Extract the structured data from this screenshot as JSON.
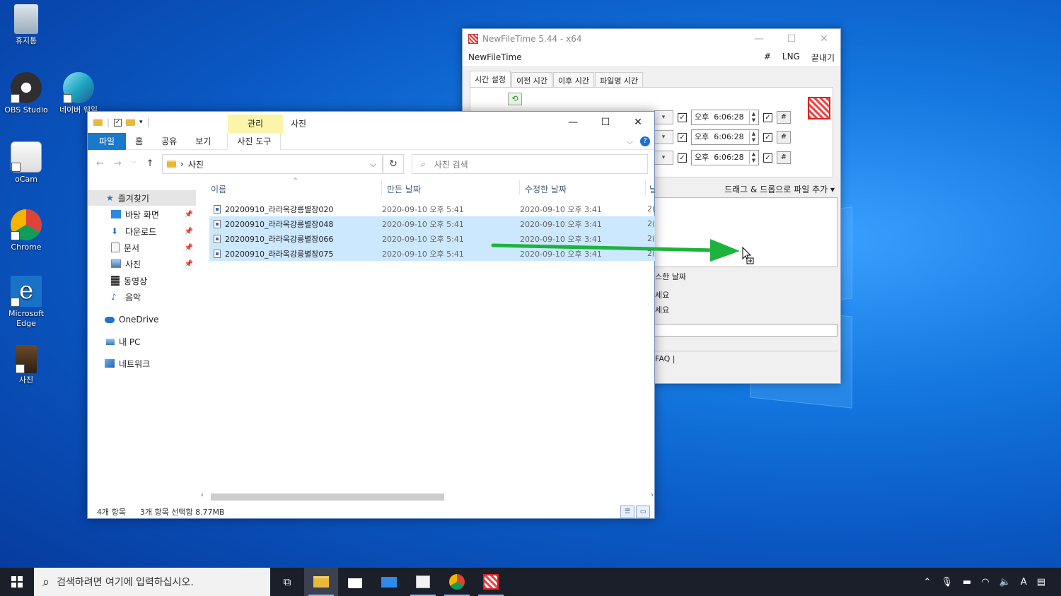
{
  "desktop": {
    "icons": [
      {
        "label": "휴지통"
      },
      {
        "label": "OBS Studio"
      },
      {
        "label": "네이버 웨일"
      },
      {
        "label": "oCam"
      },
      {
        "label": "Chrome"
      },
      {
        "label": "Microsoft Edge"
      },
      {
        "label": "사진"
      }
    ]
  },
  "newfiletime": {
    "window_title": "NewFileTime 5.44 - x64",
    "app_name": "NewFileTime",
    "menu": {
      "hash": "#",
      "lng": "LNG",
      "exit": "끝내기"
    },
    "tabs": [
      "시간 설정",
      "이전 시간",
      "이후 시간",
      "파일명 시간"
    ],
    "time_rows": [
      {
        "ampm": "오후",
        "time": "6:06:28"
      },
      {
        "ampm": "오후",
        "time": "6:06:28"
      },
      {
        "ampm": "오후",
        "time": "6:06:28"
      }
    ],
    "hash_label": "#",
    "drag_drop": "드래그 & 드롭으로 파일 추가 ▾",
    "section_partial": "스한 날짜",
    "hint1_partial": "세요",
    "hint2_partial": "세요",
    "faq_partial": "FAQ  |"
  },
  "explorer": {
    "quick_access_arrow": "▾",
    "manage_tab": "관리",
    "window_title": "사진",
    "ribbon": {
      "file": "파일",
      "home": "홈",
      "share": "공유",
      "view": "보기",
      "photo_tools": "사진 도구"
    },
    "address": {
      "path": "사진"
    },
    "search_placeholder": "사진 검색",
    "nav": {
      "favorites": "즐겨찾기",
      "items": [
        "바탕 화면",
        "다운로드",
        "문서",
        "사진",
        "동영상",
        "음악"
      ],
      "onedrive": "OneDrive",
      "pc": "내 PC",
      "network": "네트워크"
    },
    "columns": {
      "name": "이름",
      "created": "만든 날짜",
      "modified": "수정한 날짜",
      "extra": "날"
    },
    "files": [
      {
        "name": "20200910_라라옥강릉별장020",
        "created": "2020-09-10 오후 5:41",
        "modified": "2020-09-10 오후 3:41",
        "extra": "2(",
        "selected": false
      },
      {
        "name": "20200910_라라옥강릉별장048",
        "created": "2020-09-10 오후 5:41",
        "modified": "2020-09-10 오후 3:41",
        "extra": "2(",
        "selected": true
      },
      {
        "name": "20200910_라라옥강릉별장066",
        "created": "2020-09-10 오후 5:41",
        "modified": "2020-09-10 오후 3:41",
        "extra": "2(",
        "selected": true
      },
      {
        "name": "20200910_라라옥강릉별장075",
        "created": "2020-09-10 오후 5:41",
        "modified": "2020-09-10 오후 3:41",
        "extra": "2(",
        "selected": true
      }
    ],
    "status": {
      "count": "4개 항목",
      "selection": "3개 항목 선택함 8.77MB"
    }
  },
  "taskbar": {
    "search_placeholder": "검색하려면 여기에 입력하십시오.",
    "ime": "A"
  },
  "colors": {
    "selection": "#cce8ff",
    "ribbon_file": "#1979ca",
    "manage_tab": "#fbf5a9",
    "drag_arrow": "#1db33c"
  }
}
